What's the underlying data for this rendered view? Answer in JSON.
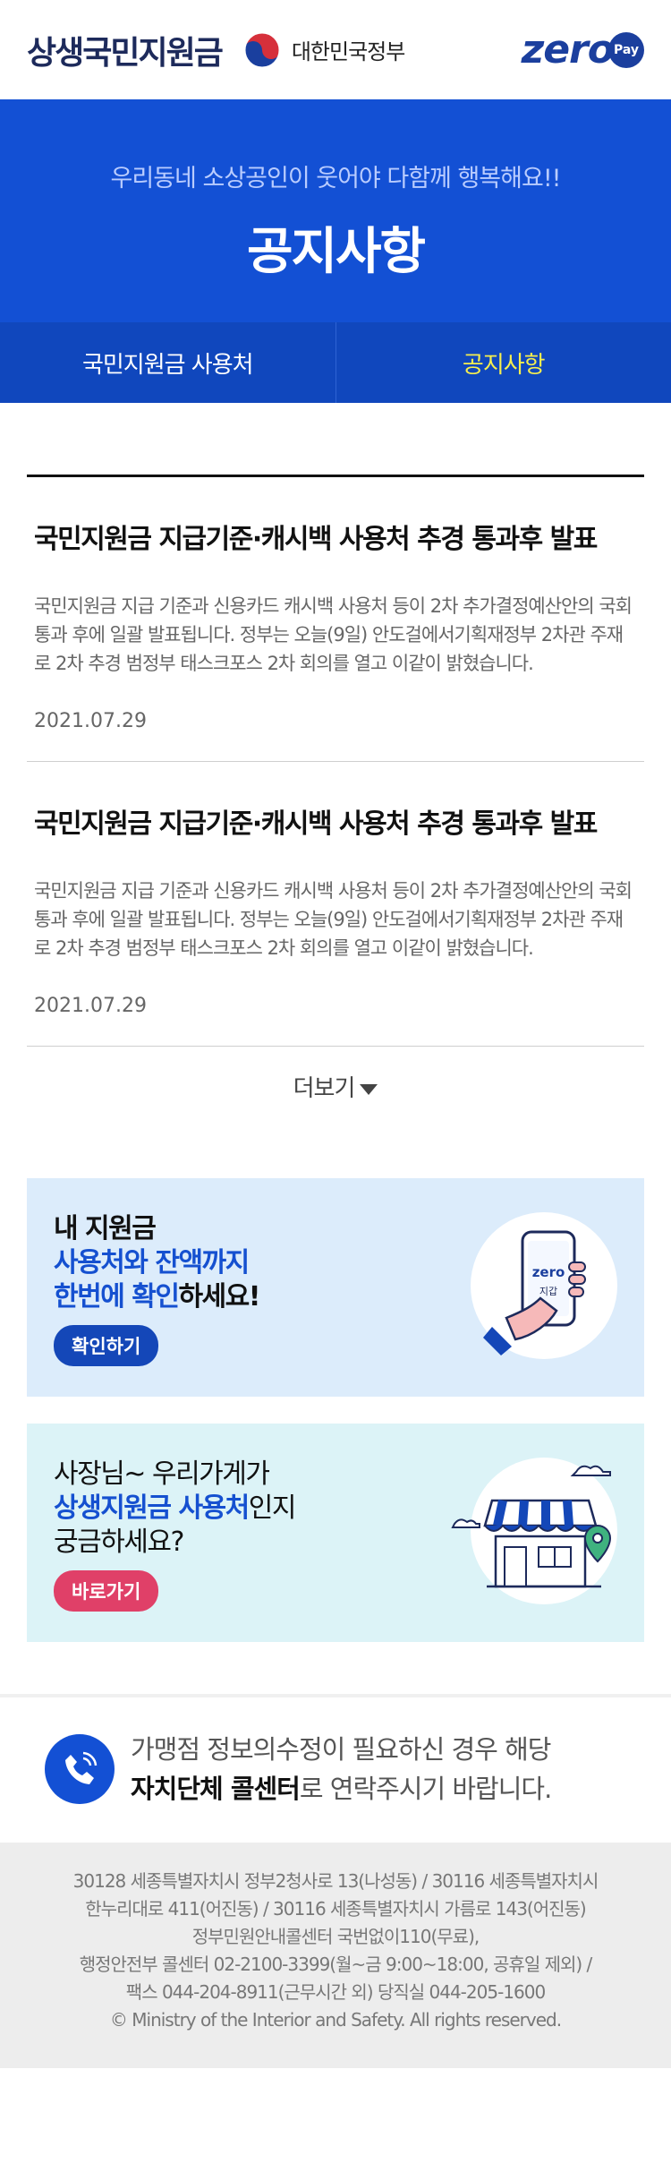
{
  "header": {
    "brand": "상생국민지원금",
    "gov_label": "대한민국정부",
    "zero_text": "zero",
    "zero_pay": "Pay"
  },
  "hero": {
    "subtitle": "우리동네 소상공인이 웃어야 다함께 행복해요!!",
    "title": "공지사항"
  },
  "tabs": [
    {
      "label": "국민지원금 사용처",
      "active": false
    },
    {
      "label": "공지사항",
      "active": true
    }
  ],
  "notices": [
    {
      "title": "국민지원금 지급기준·캐시백 사용처 추경 통과후 발표",
      "body": "국민지원금 지급 기준과 신용카드 캐시백 사용처 등이 2차 추가결정예산안의 국회 통과 후에 일괄 발표됩니다. 정부는 오늘(9일) 안도걸에서기획재정부 2차관 주재로 2차 추경 범정부 태스크포스 2차 회의를 열고 이같이 밝혔습니다.",
      "date": "2021.07.29"
    },
    {
      "title": "국민지원금 지급기준·캐시백 사용처 추경 통과후 발표",
      "body": "국민지원금 지급 기준과 신용카드 캐시백 사용처 등이 2차 추가결정예산안의 국회 통과 후에 일괄 발표됩니다. 정부는 오늘(9일) 안도걸에서기획재정부 2차관 주재로 2차 추경 범정부 태스크포스 2차 회의를 열고 이같이 밝혔습니다.",
      "date": "2021.07.29"
    }
  ],
  "more_label": "더보기",
  "banners": {
    "check": {
      "line1": "내 지원금",
      "line2": "사용처와 잔액까지",
      "line3_hl": "한번에 확인",
      "line3_rest": "하세요!",
      "button": "확인하기",
      "phone_brand": "zero",
      "phone_sub": "지갑"
    },
    "store": {
      "line1": "사장님~ 우리가게가",
      "line2_hl": "상생지원금 사용처",
      "line2_rest": "인지",
      "line3": "궁금하세요?",
      "button": "바로가기"
    }
  },
  "call": {
    "line1": "가맹점 정보의수정이 필요하신 경우 해당",
    "line2_bold": "자치단체 콜센터",
    "line2_rest": "로 연락주시기 바랍니다."
  },
  "footer": {
    "lines": [
      "30128 세종특별자치시 정부2청사로 13(나성동) / 30116 세종특별자치시",
      "한누리대로 411(어진동) / 30116 세종특별자치시 가름로 143(어진동)",
      "정부민원안내콜센터 국번없이110(무료),",
      "행정안전부 콜센터 02-2100-3399(월~금 9:00~18:00, 공휴일 제외) /",
      "팩스 044-204-8911(근무시간 외) 당직실 044-205-1600",
      "© Ministry of the Interior and Safety. All rights reserved."
    ]
  },
  "colors": {
    "primary": "#1350d4",
    "tab_bg": "#1047bd",
    "tab_active": "#f5ee4f",
    "banner1_bg": "#dcecfb",
    "banner2_bg": "#dcf3f7",
    "pink": "#e04068"
  }
}
